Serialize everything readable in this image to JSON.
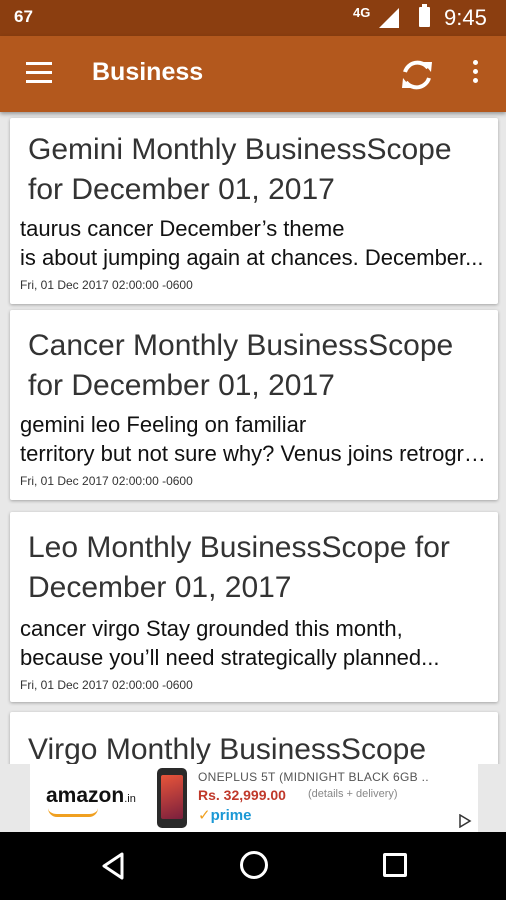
{
  "status_bar": {
    "left_text": "67",
    "network": "4G",
    "time": "9:45"
  },
  "toolbar": {
    "title": "Business",
    "icons": [
      "menu-icon",
      "refresh-icon",
      "more-vert-icon"
    ]
  },
  "articles": [
    {
      "title": "Gemini Monthly BusinessScope for December 01, 2017",
      "body_line1": "taurus   cancer  December’s theme",
      "body_line2": "is about jumping again at chances. December...",
      "date": "Fri, 01 Dec 2017 02:00:00 -0600"
    },
    {
      "title": "Cancer Monthly BusinessScope for December 01, 2017",
      "body_line1": "gemini   leo  Feeling on familiar",
      "body_line2": "territory but not sure why? Venus joins retrograde...",
      "date": "Fri, 01 Dec 2017 02:00:00 -0600"
    },
    {
      "title": "Leo Monthly BusinessScope for December 01, 2017",
      "body_line1": "cancer   virgo  Stay grounded this month,",
      "body_line2": "because you’ll need strategically planned...",
      "date": "Fri, 01 Dec 2017 02:00:00 -0600"
    },
    {
      "title": "Virgo Monthly BusinessScope"
    }
  ],
  "ad": {
    "brand": "amazon",
    "brand_suffix": ".in",
    "product": "ONEPLUS 5T (MIDNIGHT BLACK 6GB ..",
    "price": "Rs. 32,999.00",
    "details": "(details + delivery)",
    "prime_check": "✓",
    "prime": "prime"
  },
  "colors": {
    "status_bar": "#8b3e10",
    "toolbar": "#b3581d",
    "background": "#e8e8e8"
  }
}
